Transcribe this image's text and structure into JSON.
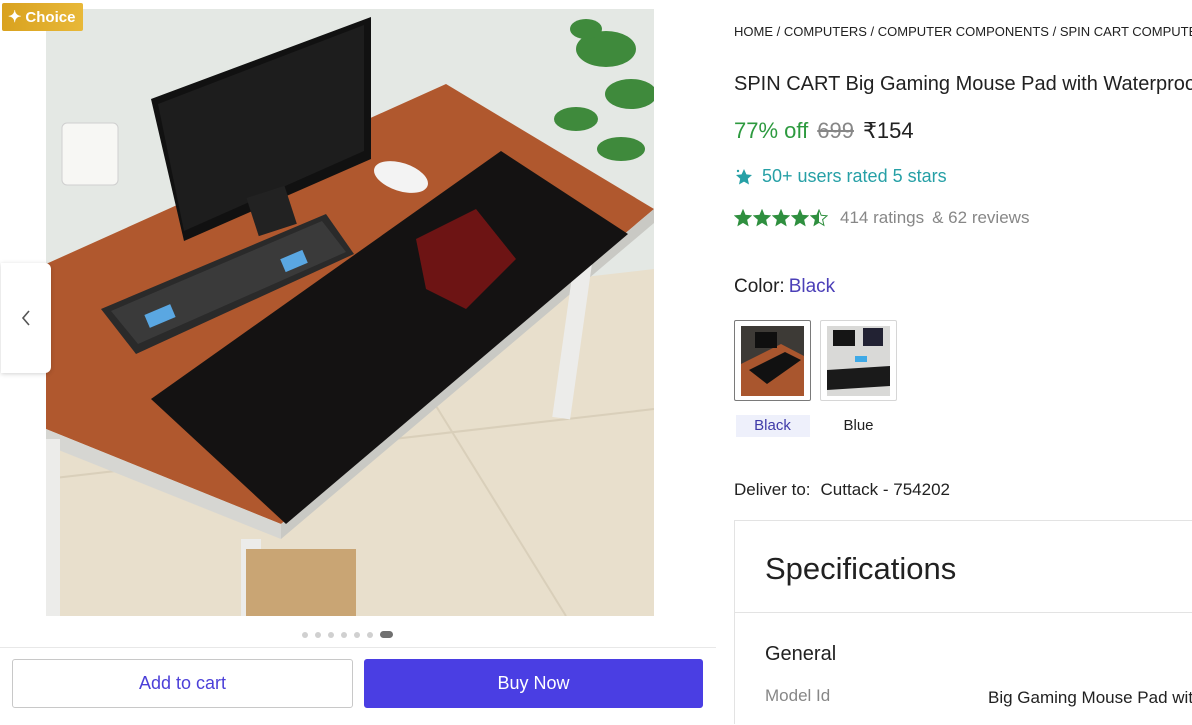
{
  "badge": {
    "icon": "sparkle-icon",
    "label": "Choice"
  },
  "gallery": {
    "dot_count": 7,
    "active_dot": 6,
    "prev_icon": "chevron-left-icon"
  },
  "actions": {
    "add_to_cart": "Add to cart",
    "buy_now": "Buy Now"
  },
  "breadcrumb": [
    "HOME",
    "COMPUTERS",
    "COMPUTER COMPONENTS",
    "SPIN CART COMPUTER"
  ],
  "product": {
    "title": "SPIN CART Big Gaming Mouse Pad with Waterproof",
    "discount": "77% off",
    "mrp": "699",
    "price": "₹154",
    "users_rated": "50+ users rated 5 stars",
    "rating_stars": 4.5,
    "ratings": "414 ratings",
    "reviews": "& 62 reviews"
  },
  "color": {
    "label": "Color:",
    "selected": "Black",
    "options": [
      {
        "label": "Black",
        "selected": true
      },
      {
        "label": "Blue",
        "selected": false
      }
    ]
  },
  "delivery": {
    "label": "Deliver to:",
    "location": "Cuttack - 754202"
  },
  "specs": {
    "title": "Specifications",
    "section": "General",
    "rows": [
      {
        "key": "Model Id",
        "value": "Big Gaming Mouse Pad with"
      }
    ]
  },
  "colors": {
    "accent": "#4a3ee3",
    "discount_green": "#2d9a3f",
    "teal": "#26a0a6",
    "badge_gold": "#e0ad2c",
    "star_green": "#2f8f3f"
  }
}
